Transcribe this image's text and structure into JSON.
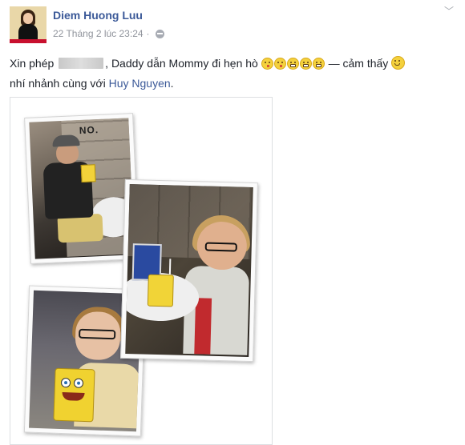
{
  "post": {
    "author_name": "Diem Huong Luu",
    "timestamp": "22 Tháng 2 lúc 23:24",
    "privacy_icon": "globe-icon",
    "options_icon": "chevron-down-icon",
    "text": {
      "prefix": "Xin phép",
      "middle": ", Daddy dẫn Mommy đi hẹn hò",
      "feeling": "— cảm thấy",
      "line2_prefix": "nhí nhảnh cùng với",
      "tagged_person": "Huy Nguyen",
      "line2_suffix": "."
    },
    "emoticons": [
      "kiss-emoji",
      "kiss-emoji",
      "grin-emoji",
      "grin-emoji",
      "grin-emoji"
    ],
    "feeling_icon": "smile-emoji",
    "photo_collage": {
      "sign_text": "NO."
    }
  },
  "colors": {
    "link": "#3b5998",
    "meta": "#90949c",
    "text": "#1d2129"
  }
}
